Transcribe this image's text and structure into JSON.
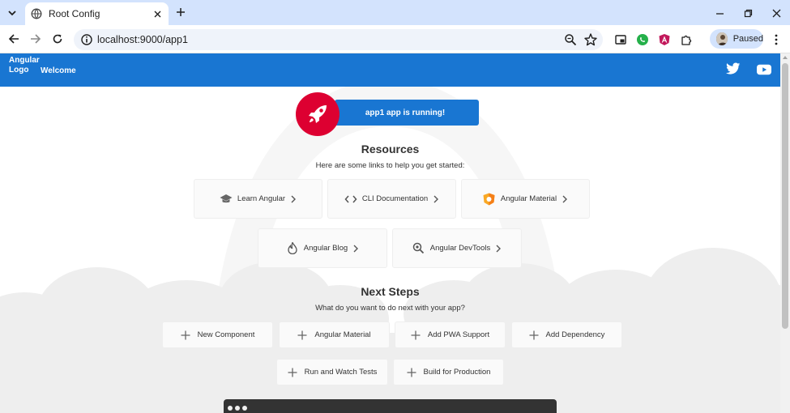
{
  "browser": {
    "tab_title": "Root Config",
    "url": "localhost:9000/app1",
    "profile_label": "Paused"
  },
  "app": {
    "logo_alt": "Angular Logo",
    "welcome": "Welcome",
    "running_text": "app1 app is running!"
  },
  "resources": {
    "title": "Resources",
    "subtitle": "Here are some links to help you get started:",
    "cards": [
      {
        "label": "Learn Angular",
        "icon": "school-icon"
      },
      {
        "label": "CLI Documentation",
        "icon": "code-icon"
      },
      {
        "label": "Angular Material",
        "icon": "material-shield-icon"
      },
      {
        "label": "Angular Blog",
        "icon": "flame-icon"
      },
      {
        "label": "Angular DevTools",
        "icon": "devtools-magnify-icon"
      }
    ]
  },
  "next_steps": {
    "title": "Next Steps",
    "subtitle": "What do you want to do next with your app?",
    "items": [
      {
        "label": "New Component"
      },
      {
        "label": "Angular Material"
      },
      {
        "label": "Add PWA Support"
      },
      {
        "label": "Add Dependency"
      },
      {
        "label": "Run and Watch Tests"
      },
      {
        "label": "Build for Production"
      }
    ]
  },
  "colors": {
    "primary": "#1976d2",
    "rocket_bg": "#dd0031",
    "material_shield": "#f9a825",
    "chrome_frame": "#d3e3fd"
  }
}
